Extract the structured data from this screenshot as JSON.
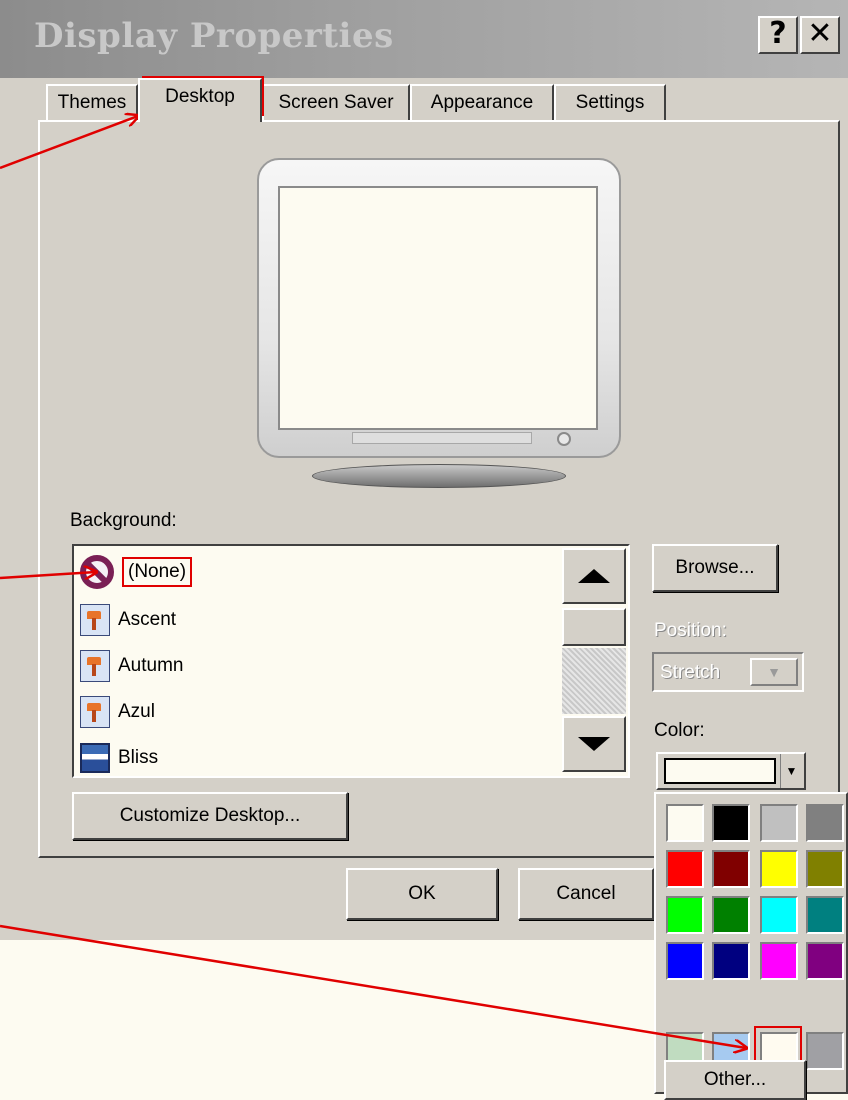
{
  "window": {
    "title": "Display Properties",
    "help": "?",
    "close": "✕"
  },
  "tabs": [
    "Themes",
    "Desktop",
    "Screen Saver",
    "Appearance",
    "Settings"
  ],
  "background": {
    "label": "Background:",
    "items": [
      "(None)",
      "Ascent",
      "Autumn",
      "Azul",
      "Bliss"
    ],
    "selected": "(None)"
  },
  "buttons": {
    "browse": "Browse...",
    "customize": "Customize Desktop...",
    "ok": "OK",
    "cancel": "Cancel",
    "other": "Other..."
  },
  "position": {
    "label": "Position:",
    "value": "Stretch",
    "disabled": true
  },
  "color": {
    "label": "Color:",
    "current": "#fdfbf1"
  },
  "palette": {
    "rows": [
      [
        "#fdfbf1",
        "#000000",
        "#c0c0c0",
        "#808080"
      ],
      [
        "#ff0000",
        "#800000",
        "#ffff00",
        "#808000"
      ],
      [
        "#00ff00",
        "#008000",
        "#00ffff",
        "#008080"
      ],
      [
        "#0000ff",
        "#000080",
        "#ff00ff",
        "#800080"
      ],
      [
        "#c0dcc0",
        "#a6caf0",
        "#fffbf0",
        "#a0a0a4"
      ]
    ],
    "selected": "#fffbf0"
  },
  "icons": {
    "help": "help-icon",
    "close": "close-icon",
    "none": "no-background-icon",
    "wallpaper": "wallpaper-image-icon",
    "bliss": "bliss-image-icon",
    "scroll_up": "triangle-up-icon",
    "scroll_down": "triangle-down-icon"
  },
  "annotation_color": "#e00000"
}
